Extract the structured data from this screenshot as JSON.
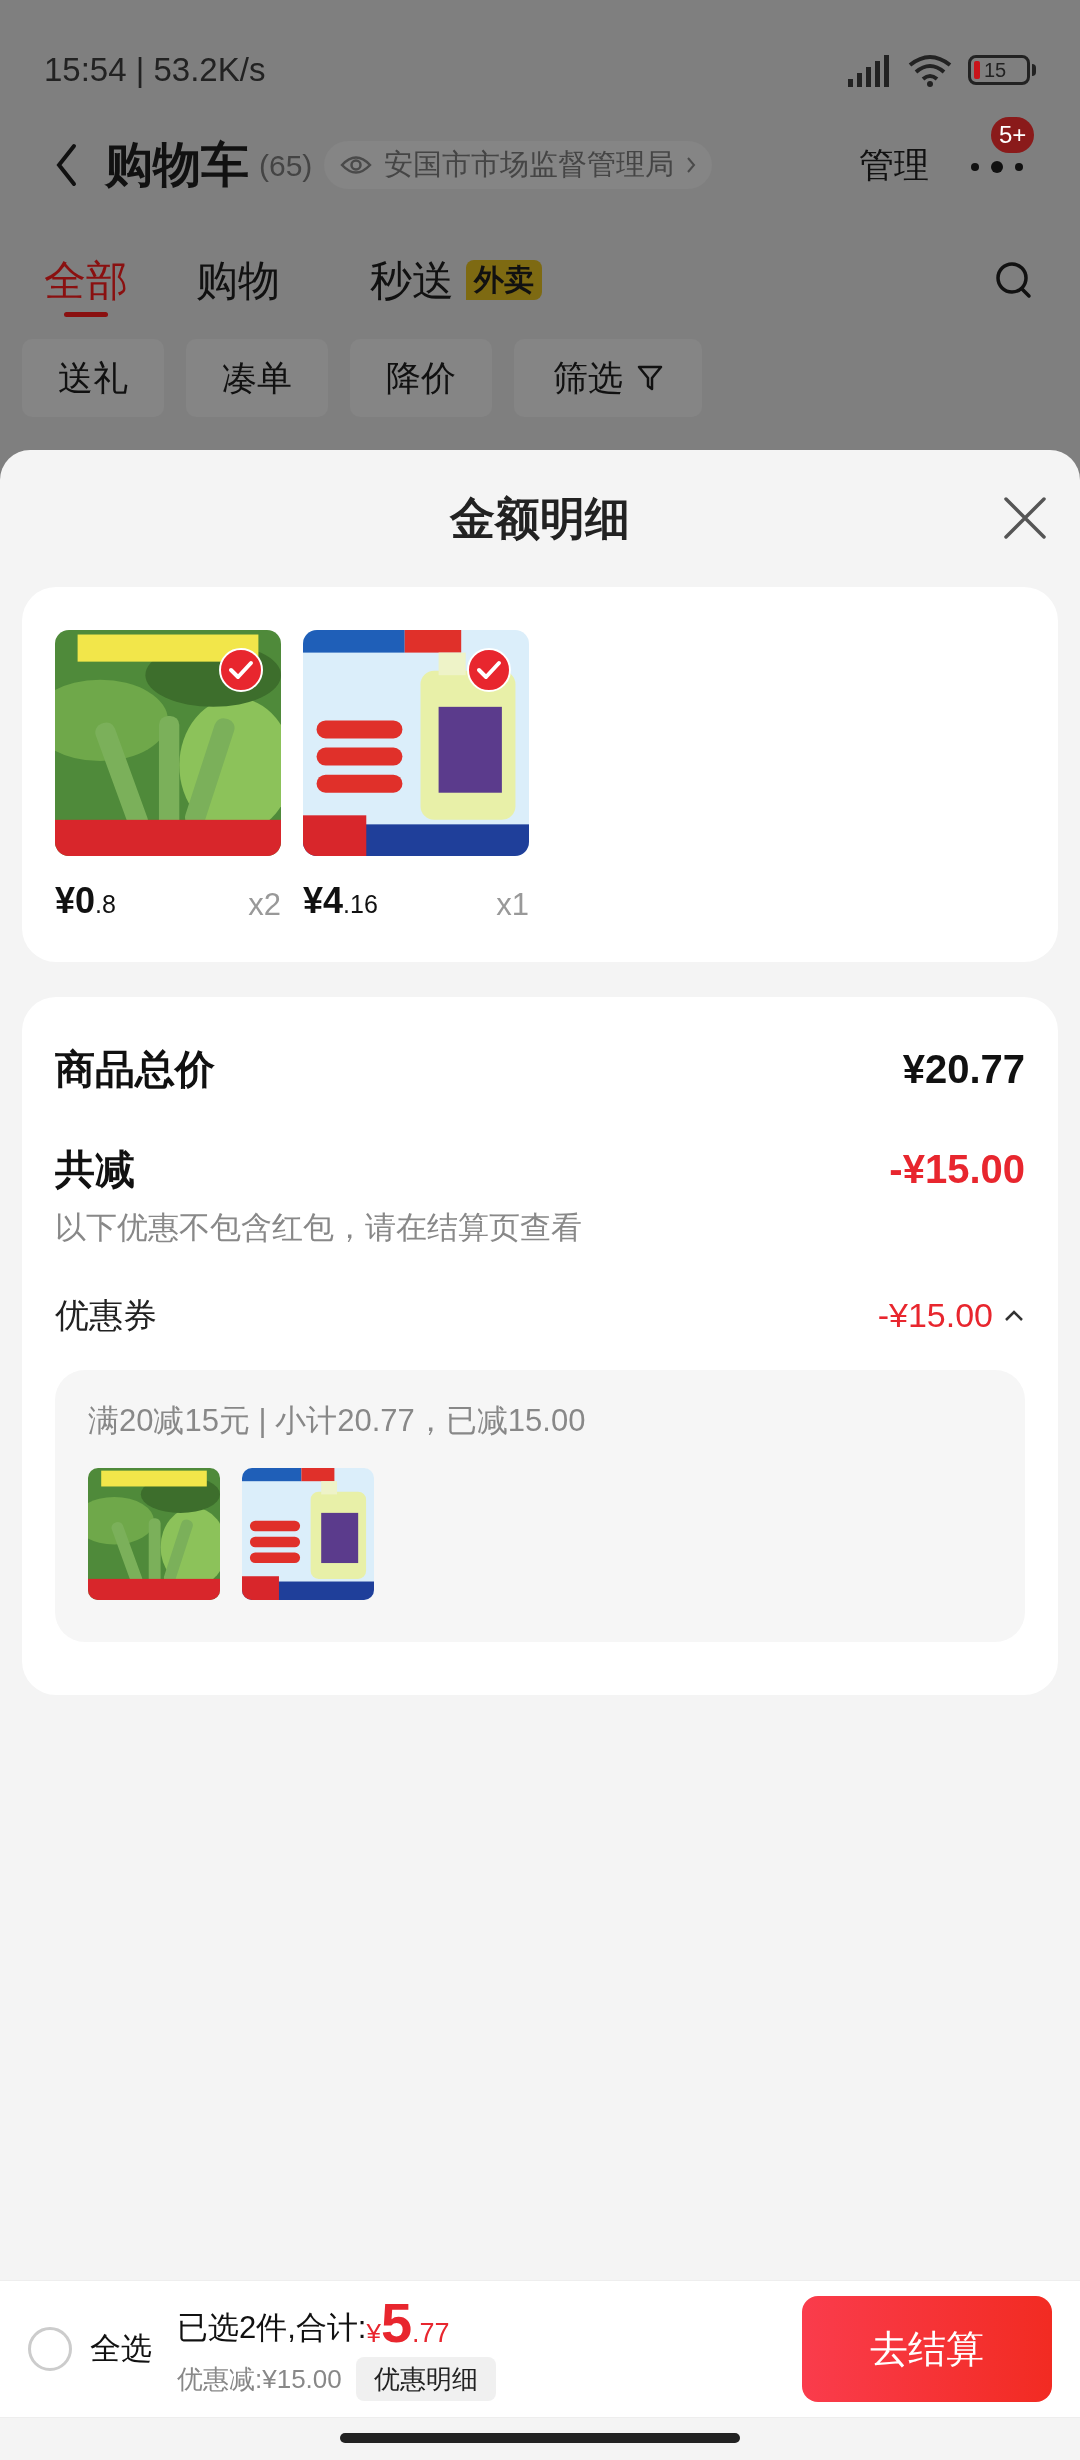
{
  "status_bar": {
    "time": "15:54 | 53.2K/s",
    "battery": "15"
  },
  "header": {
    "title": "购物车",
    "count": "(65)",
    "location": "安国市市场监督管理局",
    "manage": "管理",
    "badge": "5+"
  },
  "tabs": [
    {
      "label": "全部",
      "selected": true
    },
    {
      "label": "购物",
      "selected": false
    },
    {
      "label": "秒送",
      "selected": false,
      "tag": "外卖"
    }
  ],
  "filters": [
    {
      "label": "送礼",
      "kind": "plain"
    },
    {
      "label": "凑单",
      "kind": "plain"
    },
    {
      "label": "降价",
      "kind": "plain"
    },
    {
      "label": "筛选",
      "kind": "filter"
    }
  ],
  "sheet": {
    "title": "金额明细",
    "items": [
      {
        "kind": "plant",
        "price": "¥0",
        "price_decimal": ".8",
        "quantity": "x2",
        "checked": true
      },
      {
        "kind": "jug",
        "price": "¥4",
        "price_decimal": ".16",
        "quantity": "x1",
        "checked": true
      }
    ],
    "total_label": "商品总价",
    "total_value": "¥20.77",
    "reduce_label": "共减",
    "reduce_value": "-¥15.00",
    "note": "以下优惠不包含红包，请在结算页查看",
    "coupon": {
      "label": "优惠券",
      "value": "-¥15.00",
      "expanded": true,
      "rule": "满20减15元 | 小计20.77，已减15.00",
      "thumbs": [
        {
          "kind": "plant"
        },
        {
          "kind": "jug"
        }
      ]
    }
  },
  "bottom_bar": {
    "select_all": {
      "label": "全选",
      "checked": false
    },
    "summary": "已选2件,合计:",
    "currency": "¥",
    "amount": "5",
    "amount_decimal": ".77",
    "discount": "优惠减:¥15.00",
    "detail_button": "优惠明细",
    "checkout": "去结算"
  }
}
